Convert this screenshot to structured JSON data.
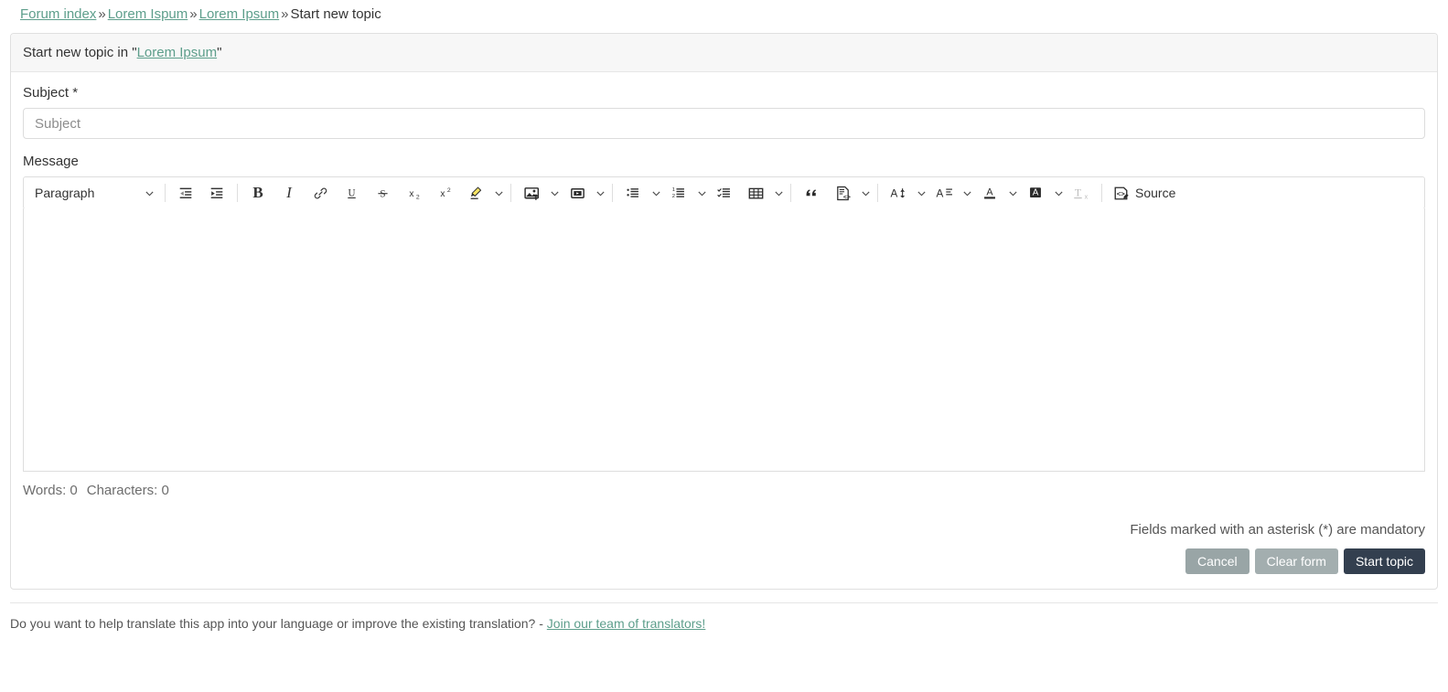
{
  "breadcrumb": {
    "items": [
      {
        "label": "Forum index",
        "link": true
      },
      {
        "label": "Lorem Ispum",
        "link": true
      },
      {
        "label": "Lorem Ipsum",
        "link": true
      },
      {
        "label": "Start new topic",
        "link": false
      }
    ],
    "separator": "»"
  },
  "panel": {
    "header_prefix": "Start new topic in \"",
    "header_link": "Lorem Ipsum",
    "header_suffix": "\""
  },
  "form": {
    "subject": {
      "label": "Subject *",
      "placeholder": "Subject",
      "value": ""
    },
    "message": {
      "label": "Message",
      "value": ""
    },
    "mandatory_note": "Fields marked with an asterisk (*) are mandatory"
  },
  "editor": {
    "paragraph_dropdown": "Paragraph",
    "source_label": "Source",
    "buttons": [
      {
        "name": "paragraph-format-dropdown",
        "label": "Paragraph"
      },
      {
        "name": "decrease-indent-icon",
        "label": "Decrease indent"
      },
      {
        "name": "increase-indent-icon",
        "label": "Increase indent"
      },
      {
        "name": "bold-icon",
        "label": "Bold"
      },
      {
        "name": "italic-icon",
        "label": "Italic"
      },
      {
        "name": "link-icon",
        "label": "Link"
      },
      {
        "name": "underline-icon",
        "label": "Underline"
      },
      {
        "name": "strikethrough-icon",
        "label": "Strikethrough"
      },
      {
        "name": "subscript-icon",
        "label": "Subscript"
      },
      {
        "name": "superscript-icon",
        "label": "Superscript"
      },
      {
        "name": "highlight-icon",
        "label": "Highlight"
      },
      {
        "name": "image-upload-icon",
        "label": "Insert image"
      },
      {
        "name": "media-embed-icon",
        "label": "Insert media"
      },
      {
        "name": "bulleted-list-icon",
        "label": "Bulleted list"
      },
      {
        "name": "numbered-list-icon",
        "label": "Numbered list"
      },
      {
        "name": "todo-list-icon",
        "label": "To-do list"
      },
      {
        "name": "table-icon",
        "label": "Insert table"
      },
      {
        "name": "block-quote-icon",
        "label": "Block quote"
      },
      {
        "name": "code-block-icon",
        "label": "Code block"
      },
      {
        "name": "font-size-icon",
        "label": "Font size"
      },
      {
        "name": "font-family-icon",
        "label": "Font family"
      },
      {
        "name": "font-color-icon",
        "label": "Font color"
      },
      {
        "name": "font-background-color-icon",
        "label": "Font background color"
      },
      {
        "name": "remove-format-icon",
        "label": "Remove format"
      },
      {
        "name": "source-button",
        "label": "Source"
      }
    ]
  },
  "status": {
    "words": "Words: 0",
    "characters": "Characters: 0"
  },
  "actions": {
    "cancel": "Cancel",
    "clear_form": "Clear form",
    "start_topic": "Start topic"
  },
  "footer": {
    "text": "Do you want to help translate this app into your language or improve the existing translation? - ",
    "link": "Join our team of translators!"
  },
  "colors": {
    "link_green": "#5d9e8b",
    "primary_button": "#333f4f",
    "muted_button": "#99a5a6",
    "highlight_yellow": "#f7e463",
    "border": "#dedede"
  }
}
